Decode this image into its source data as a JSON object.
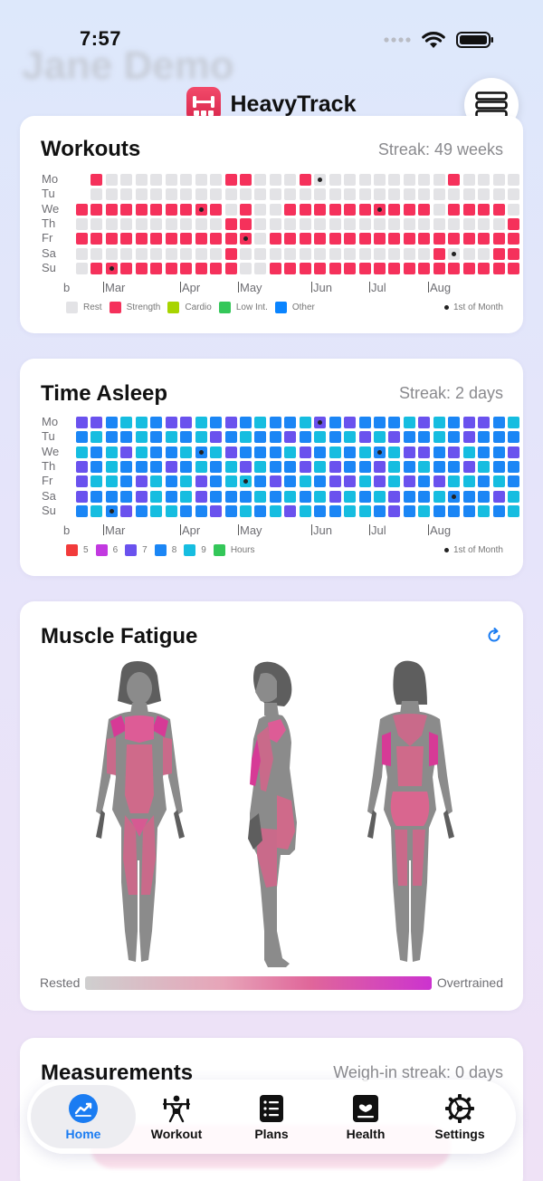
{
  "status_bar": {
    "time": "7:57"
  },
  "background_title": "Jane Demo",
  "app": {
    "name": "HeavyTrack"
  },
  "day_labels": [
    "Mo",
    "Tu",
    "We",
    "Th",
    "Fr",
    "Sa",
    "Su"
  ],
  "month_labels": [
    "b",
    "Mar",
    "Apr",
    "May",
    "Jun",
    "Jul",
    "Aug"
  ],
  "workouts": {
    "title": "Workouts",
    "streak": "Streak: 49 weeks",
    "colors": {
      "rest": "#e3e3e6",
      "strength": "#f5315b",
      "cardio": "#a7d400",
      "low_int": "#34c759",
      "other": "#0a84ff"
    },
    "legend": [
      {
        "label": "Rest",
        "color": "#e3e3e6"
      },
      {
        "label": "Strength",
        "color": "#f5315b"
      },
      {
        "label": "Cardio",
        "color": "#a7d400"
      },
      {
        "label": "Low Int.",
        "color": "#34c759"
      },
      {
        "label": "Other",
        "color": "#0a84ff"
      }
    ],
    "first_of_month": "1st of Month",
    "grid": [
      "0SRRRRRRRRSSRRRSRRRRRRRRRSRRRRSRSS",
      "0RRRRRRRRRRRRRRRRRRRRRRRRRRRRRRRRR",
      "SSSSSSSSSSRSRRSSSSSSSSSSRSSSSRSSRS",
      "RRRRRRRRRRSSRRRRRRRRRRRRRRRRRSRRSS",
      "SSSSSSSSSSSSRSSSSSSSSSSSSSSSSSSSSS",
      "RRRRRRRRRRSRRRRRRRRRRRRRSRRRSSRSSR",
      "RSSSSSSSSSSRRSSSSSSSSSSSSSSSSSSSSR"
    ]
  },
  "sleep": {
    "title": "Time Asleep",
    "streak": "Streak: 2 days",
    "colors": {
      "5": "#f23b3b",
      "6": "#c239e0",
      "7": "#6a52ee",
      "8": "#1b86f5",
      "9": "#16bde0",
      "rest": "#e3e3e6"
    },
    "legend": [
      {
        "label": "5",
        "color": "#f23b3b"
      },
      {
        "label": "6",
        "color": "#c239e0"
      },
      {
        "label": "7",
        "color": "#6a52ee"
      },
      {
        "label": "8",
        "color": "#1b86f5"
      },
      {
        "label": "9",
        "color": "#16bde0"
      },
      {
        "label": "Hours",
        "color": "#34c759"
      }
    ],
    "first_of_month": "1st of Month",
    "grid": [
      "7789987798789889787888979877897989",
      "8988989897898878989797889878888989",
      "98979889897888978989897787988798R0",
      "7898887898979887978879898879888897",
      "7998798978998789877979787998988997",
      "7888798978889898979897889888798979",
      "8987899887898979889987898889898897"
    ]
  },
  "fatigue": {
    "title": "Muscle Fatigue",
    "scale_min": "Rested",
    "scale_max": "Overtrained",
    "colors": {
      "rested": "#cfcfcf",
      "mid": "#e0669a",
      "high": "#cc33cf",
      "body": "#8b8b8b"
    }
  },
  "measurements": {
    "title": "Measurements",
    "streak": "Weigh-in streak: 0 days"
  },
  "tabs": [
    {
      "label": "Home",
      "icon": "chart-icon",
      "active": true
    },
    {
      "label": "Workout",
      "icon": "weightlifter-icon",
      "active": false
    },
    {
      "label": "Plans",
      "icon": "list-icon",
      "active": false
    },
    {
      "label": "Health",
      "icon": "heart-card-icon",
      "active": false
    },
    {
      "label": "Settings",
      "icon": "gear-icon",
      "active": false
    }
  ]
}
